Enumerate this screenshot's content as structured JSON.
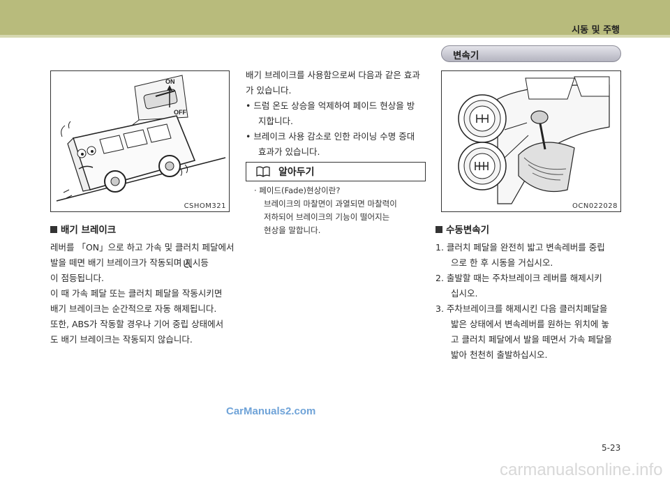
{
  "header": {
    "section_title": "시동 및 주행"
  },
  "left": {
    "figure": {
      "code": "CSHOM321",
      "switch_on": "ON",
      "switch_off": "OFF"
    },
    "subheading": "배기 브레이크",
    "paragraph_lines": [
      "레버를 「ON」으로 하고 가속 및 클러치 페달에서",
      "발을 떼면 배기 브레이크가 작동되며 지시등",
      "이 점등됩니다.",
      "이 때 가속 페달 또는 클러치 페달을 작동시키면",
      "배기 브레이크는 순간적으로 자동 해제됩니다.",
      "또한, ABS가 작동할 경우나 기어 중립 상태에서",
      "도 배기 브레이크는 작동되지 않습니다."
    ]
  },
  "middle": {
    "intro_lines": [
      "배기 브레이크를 사용함으로써 다음과 같은 효과",
      "가 있습니다."
    ],
    "bullets": [
      {
        "line1": "•  드럼 온도 상승을 억제하여 페이드 현상을 방",
        "line2": "지합니다."
      },
      {
        "line1": "•  브레이크 사용 감소로 인한 라이닝 수명 증대",
        "line2": "효과가 있습니다."
      }
    ],
    "tip_label": "알아두기",
    "tip_title": "· 페이드(Fade)현상이란?",
    "tip_lines": [
      "브레이크의 마찰면이 과열되면 마찰력이",
      "저하되어 브레이크의 기능이 떨어지는",
      "현상을 말합니다."
    ]
  },
  "right": {
    "pill_title": "변속기",
    "figure": {
      "code": "OCN022028"
    },
    "subheading": "수동변속기",
    "items": [
      {
        "line1": "1.  클러치 페달을 완전히 밟고 변속레버를 중립",
        "line2": "으로 한 후 시동을 거십시오."
      },
      {
        "line1": "2.  출발할 때는 주차브레이크 레버를 해제시키",
        "line2": "십시오."
      },
      {
        "line1": "3.  주차브레이크를 해제시킨 다음 클러치페달을",
        "line2": "밟은 상태에서 변속레버를 원하는 위치에 놓",
        "line3": "고 클러치 페달에서 발을 떼면서 가속 페달을",
        "line4": "밟아 천천히 출발하십시오."
      }
    ]
  },
  "footer": {
    "watermark": "CarManuals2.com",
    "page_number": "5-23",
    "brand": "carmanualsonline.info"
  }
}
